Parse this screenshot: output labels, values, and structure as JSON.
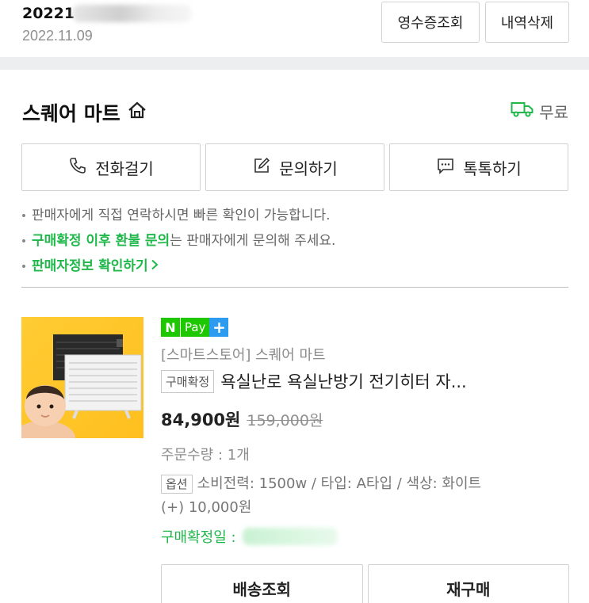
{
  "order": {
    "number_prefix": "20221",
    "date": "2022.11.09",
    "receipt_button": "영수증조회",
    "delete_button": "내역삭제"
  },
  "store": {
    "name": "스퀘어 마트",
    "shipping": "무료",
    "contact_buttons": [
      {
        "label": "전화걸기",
        "icon": "phone-icon"
      },
      {
        "label": "문의하기",
        "icon": "edit-icon"
      },
      {
        "label": "톡톡하기",
        "icon": "chat-icon"
      }
    ],
    "notices": {
      "line1": "판매자에게 직접 연락하시면 빠른 확인이 가능합니다.",
      "line2_highlight": "구매확정 이후 환불 문의",
      "line2_rest": "는 판매자에게 문의해 주세요.",
      "line3": "판매자정보 확인하기"
    }
  },
  "product": {
    "npay": {
      "n": "N",
      "pay": "Pay",
      "plus": "+"
    },
    "seller": "[스마트스토어] 스퀘어 마트",
    "status_badge": "구매확정",
    "title": "욕실난로 욕실난방기 전기히터 자...",
    "price": "84,900원",
    "original_price": "159,000원",
    "quantity": "주문수량 : 1개",
    "option_badge": "옵션",
    "option_text": "소비전력: 1500w / 타입: A타입 / 색상: 화이트",
    "option_extra": "(+) 10,000원",
    "confirm_date_label": "구매확정일 :"
  },
  "actions": {
    "shipping_lookup": "배송조회",
    "reorder": "재구매"
  },
  "colors": {
    "accent_green": "#20b84a",
    "npay_green": "#1ec800",
    "npay_blue": "#2d9cf0",
    "band_gray": "#eceef0"
  }
}
